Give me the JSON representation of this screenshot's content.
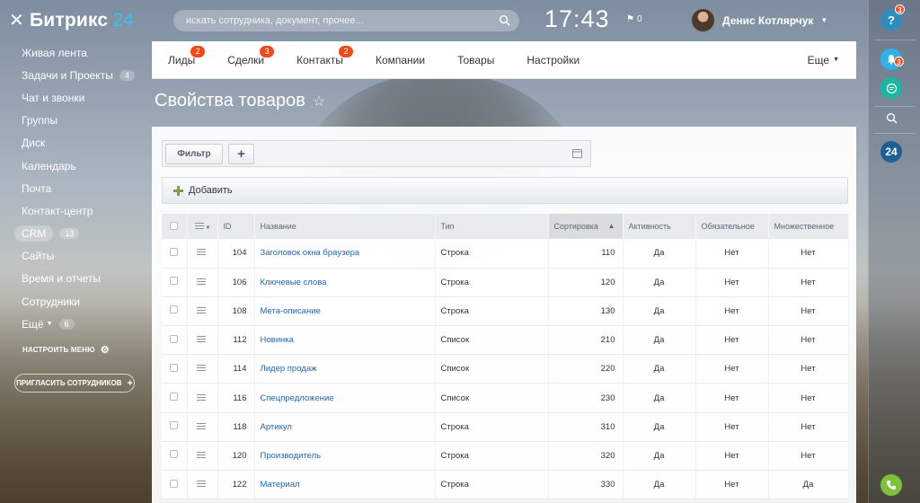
{
  "header": {
    "logo_text": "Битрикс",
    "logo_suffix": "24",
    "search_placeholder": "искать сотрудника, документ, прочее...",
    "clock": "17:43",
    "flag_count": "0",
    "user_name": "Денис Котлярчук"
  },
  "sidebar": {
    "items": [
      {
        "label": "Живая лента",
        "count": ""
      },
      {
        "label": "Задачи и Проекты",
        "count": "4"
      },
      {
        "label": "Чат и звонки",
        "count": ""
      },
      {
        "label": "Группы",
        "count": ""
      },
      {
        "label": "Диск",
        "count": ""
      },
      {
        "label": "Календарь",
        "count": ""
      },
      {
        "label": "Почта",
        "count": ""
      },
      {
        "label": "Контакт-центр",
        "count": ""
      },
      {
        "label": "CRM",
        "count": "13"
      },
      {
        "label": "Сайты",
        "count": ""
      },
      {
        "label": "Время и отчеты",
        "count": ""
      },
      {
        "label": "Сотрудники",
        "count": ""
      },
      {
        "label": "Ещё",
        "count": "6"
      }
    ],
    "settings_label": "НАСТРОИТЬ МЕНЮ",
    "invite_label": "ПРИГЛАСИТЬ СОТРУДНИКОВ"
  },
  "rightbar": {
    "help_badge": "3",
    "notif_badge": "3",
    "b24_label": "24"
  },
  "tabs": [
    {
      "label": "Лиды",
      "badge": "2"
    },
    {
      "label": "Сделки",
      "badge": "3"
    },
    {
      "label": "Контакты",
      "badge": "2"
    },
    {
      "label": "Компании",
      "badge": ""
    },
    {
      "label": "Товары",
      "badge": ""
    },
    {
      "label": "Настройки",
      "badge": ""
    }
  ],
  "tabs_more": "Еще",
  "page_title": "Свойства товаров",
  "toolbar": {
    "filter_label": "Фильтр",
    "add_label": "Добавить"
  },
  "table": {
    "columns": [
      "ID",
      "Название",
      "Тип",
      "Сортировка",
      "Активность",
      "Обязательное",
      "Множественное"
    ],
    "rows": [
      {
        "id": "104",
        "name": "Заголовок окна браузера",
        "type": "Строка",
        "sort": "110",
        "active": "Да",
        "required": "Нет",
        "multiple": "Нет"
      },
      {
        "id": "106",
        "name": "Ключевые слова",
        "type": "Строка",
        "sort": "120",
        "active": "Да",
        "required": "Нет",
        "multiple": "Нет"
      },
      {
        "id": "108",
        "name": "Мета-описание",
        "type": "Строка",
        "sort": "130",
        "active": "Да",
        "required": "Нет",
        "multiple": "Нет"
      },
      {
        "id": "112",
        "name": "Новинка",
        "type": "Список",
        "sort": "210",
        "active": "Да",
        "required": "Нет",
        "multiple": "Нет"
      },
      {
        "id": "114",
        "name": "Лидер продаж",
        "type": "Список",
        "sort": "220",
        "active": "Да",
        "required": "Нет",
        "multiple": "Нет"
      },
      {
        "id": "116",
        "name": "Спецпредложение",
        "type": "Список",
        "sort": "230",
        "active": "Да",
        "required": "Нет",
        "multiple": "Нет"
      },
      {
        "id": "118",
        "name": "Артикул",
        "type": "Строка",
        "sort": "310",
        "active": "Да",
        "required": "Нет",
        "multiple": "Нет"
      },
      {
        "id": "120",
        "name": "Производитель",
        "type": "Строка",
        "sort": "320",
        "active": "Да",
        "required": "Нет",
        "multiple": "Нет"
      },
      {
        "id": "122",
        "name": "Материал",
        "type": "Строка",
        "sort": "330",
        "active": "Да",
        "required": "Нет",
        "multiple": "Да"
      }
    ]
  },
  "colors": {
    "accent": "#2fc6f6",
    "badge": "#f54819",
    "link": "#2067b0",
    "call": "#7bc33b"
  }
}
